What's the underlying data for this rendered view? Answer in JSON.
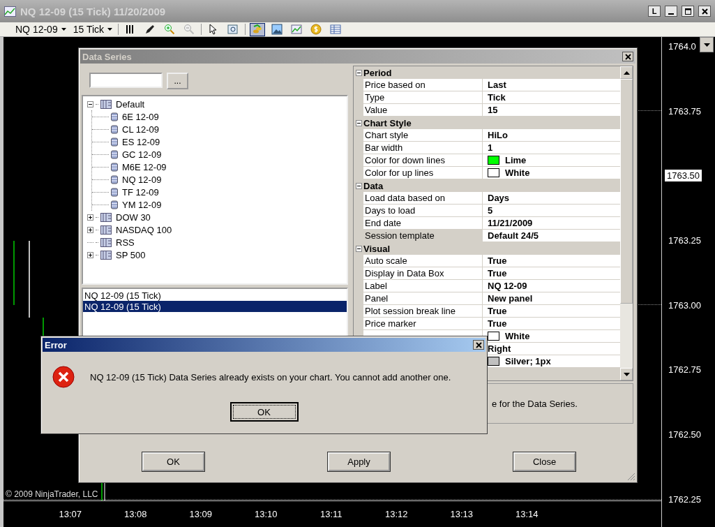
{
  "window": {
    "title": "NQ 12-09 (15 Tick)  11/20/2009",
    "buttons": [
      {
        "kind": "text",
        "label": "L"
      },
      {
        "kind": "minimize"
      },
      {
        "kind": "maximize"
      },
      {
        "kind": "close"
      }
    ]
  },
  "toolbar": {
    "instrument": "NQ 12-09",
    "period": "15 Tick",
    "tools": [
      {
        "kind": "bars",
        "selected": false
      },
      {
        "kind": "pencil",
        "selected": false
      },
      {
        "kind": "zoom-in",
        "selected": false
      },
      {
        "kind": "zoom-out",
        "selected": false
      },
      {
        "kind": "pointer",
        "selected": false
      },
      {
        "kind": "find",
        "selected": false
      },
      {
        "kind": "data-series",
        "selected": true
      },
      {
        "kind": "picture",
        "selected": false
      },
      {
        "kind": "chart",
        "selected": false
      },
      {
        "kind": "coin",
        "selected": false
      },
      {
        "kind": "table",
        "selected": false
      }
    ]
  },
  "chart": {
    "price_ticks": [
      {
        "label": "1764.0",
        "current": false
      },
      {
        "label": "1763.75",
        "current": false
      },
      {
        "label": "1763.50",
        "current": true
      },
      {
        "label": "1763.25",
        "current": false
      },
      {
        "label": "1763.00",
        "current": false
      },
      {
        "label": "1762.75",
        "current": false
      },
      {
        "label": "1762.50",
        "current": false
      },
      {
        "label": "1762.25",
        "current": false
      }
    ],
    "time_labels": [
      "13:07",
      "13:08",
      "13:09",
      "13:10",
      "13:11",
      "13:12",
      "13:13",
      "13:14"
    ],
    "copyright": "© 2009 NinjaTrader, LLC"
  },
  "data_series": {
    "title": "Data Series",
    "browse_button": "...",
    "tree": [
      {
        "label": "Default",
        "expanded": true,
        "children": [
          {
            "label": "6E 12-09"
          },
          {
            "label": "CL 12-09"
          },
          {
            "label": "ES 12-09"
          },
          {
            "label": "GC 12-09"
          },
          {
            "label": "M6E 12-09"
          },
          {
            "label": "NQ 12-09"
          },
          {
            "label": "TF 12-09"
          },
          {
            "label": "YM 12-09"
          }
        ]
      },
      {
        "label": "DOW 30",
        "expanded": false
      },
      {
        "label": "NASDAQ 100",
        "expanded": false
      },
      {
        "label": "RSS"
      },
      {
        "label": "SP 500",
        "expanded": false
      }
    ],
    "series_list": [
      {
        "label": "NQ 12-09 (15 Tick)",
        "selected": false
      },
      {
        "label": "NQ 12-09 (15 Tick)",
        "selected": true
      }
    ],
    "properties": [
      {
        "name": "Period",
        "expanded": true,
        "rows": [
          {
            "label": "Price based on",
            "value": "Last",
            "selected": false
          },
          {
            "label": "Type",
            "value": "Tick",
            "selected": false
          },
          {
            "label": "Value",
            "value": "15",
            "selected": false
          }
        ]
      },
      {
        "name": "Chart Style",
        "expanded": true,
        "rows": [
          {
            "label": "Chart style",
            "value": "HiLo",
            "selected": false
          },
          {
            "label": "Bar width",
            "value": "1",
            "selected": false
          },
          {
            "label": "Color for down lines",
            "value": "Lime",
            "color": "#00ff00",
            "selected": false
          },
          {
            "label": "Color for up lines",
            "value": "White",
            "color": "#ffffff",
            "selected": false
          }
        ]
      },
      {
        "name": "Data",
        "expanded": true,
        "rows": [
          {
            "label": "Load data based on",
            "value": "Days",
            "selected": false
          },
          {
            "label": "Days to load",
            "value": "5",
            "selected": false
          },
          {
            "label": "End date",
            "value": "11/21/2009",
            "selected": false
          },
          {
            "label": "Session template",
            "value": "Default 24/5",
            "selected": true
          }
        ]
      },
      {
        "name": "Visual",
        "expanded": true,
        "rows": [
          {
            "label": "Auto scale",
            "value": "True",
            "selected": false
          },
          {
            "label": "Display in Data Box",
            "value": "True",
            "selected": false
          },
          {
            "label": "Label",
            "value": "NQ 12-09",
            "selected": false
          },
          {
            "label": "Panel",
            "value": "New panel",
            "selected": false
          },
          {
            "label": "Plot session break line",
            "value": "True",
            "selected": false
          },
          {
            "label": "Price marker",
            "value": "True",
            "selected": false
          },
          {
            "value": "White",
            "color": "#ffffff",
            "selected": false
          },
          {
            "value": "Right",
            "selected": false
          },
          {
            "value": "Silver; 1px",
            "color": "#c0c0c0",
            "selected": false
          }
        ]
      }
    ],
    "description": "e for the Data Series.",
    "buttons": [
      "OK",
      "Apply",
      "Close"
    ]
  },
  "error": {
    "title": "Error",
    "message": "NQ 12-09 (15 Tick) Data Series already exists on your chart. You cannot add another one.",
    "button": "OK"
  }
}
